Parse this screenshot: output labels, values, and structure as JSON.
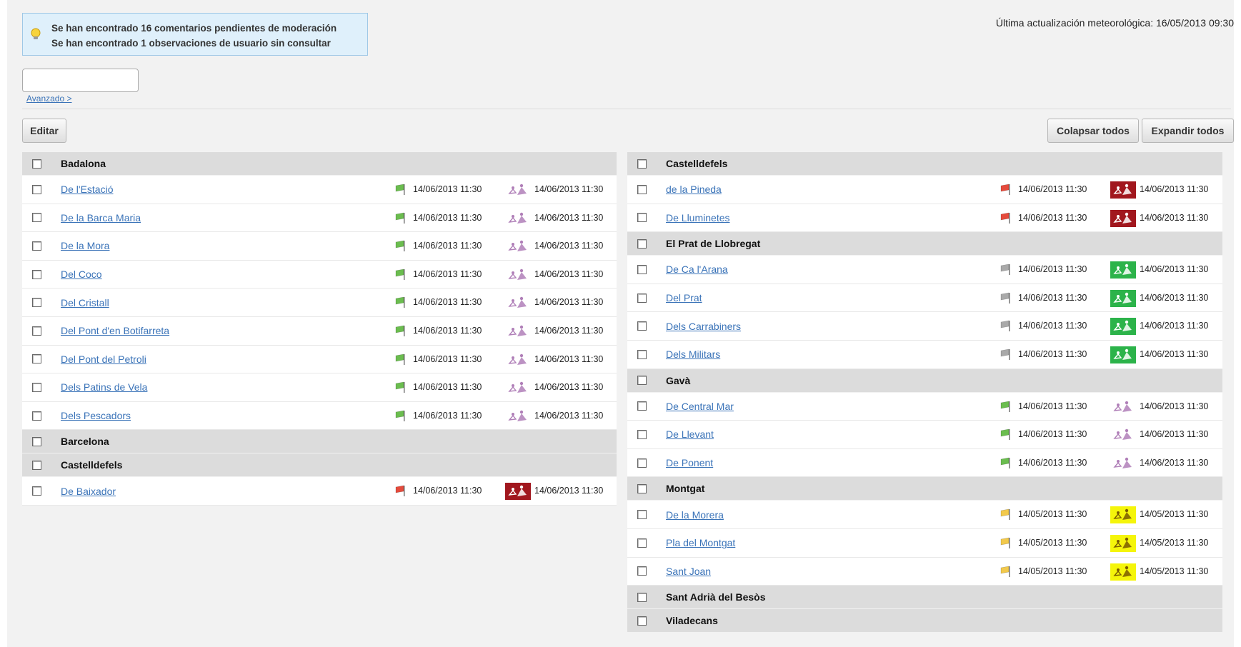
{
  "notice": {
    "line1": "Se han encontrado 16 comentarios pendientes de moderación",
    "line2": "Se han encontrado 1 observaciones de usuario sin consultar"
  },
  "weather_update": "Última actualización meteorológica: 16/05/2013 09:30",
  "search": {
    "value": "",
    "placeholder": ""
  },
  "advanced_label": "Avanzado >",
  "buttons": {
    "edit": "Editar",
    "collapse_all": "Colapsar todos",
    "expand_all": "Expandir todos"
  },
  "colors": {
    "flag_green": "#6bbd4f",
    "flag_red": "#e54b3c",
    "flag_gray": "#a9a9a9",
    "flag_yellow": "#f2c94c",
    "badge_darkred": "#a1171e",
    "badge_green": "#2cb34a",
    "badge_yellow": "#f5f50a",
    "surfer_purple": "#b07fb8"
  },
  "left_column": [
    {
      "type": "group",
      "name": "Badalona"
    },
    {
      "type": "beach",
      "name": "De l'Estació",
      "flag": "green",
      "date1": "14/06/2013 11:30",
      "badge": "none",
      "date2": "14/06/2013 11:30"
    },
    {
      "type": "beach",
      "name": "De la Barca Maria",
      "flag": "green",
      "date1": "14/06/2013 11:30",
      "badge": "none",
      "date2": "14/06/2013 11:30"
    },
    {
      "type": "beach",
      "name": "De la Mora",
      "flag": "green",
      "date1": "14/06/2013 11:30",
      "badge": "none",
      "date2": "14/06/2013 11:30"
    },
    {
      "type": "beach",
      "name": "Del Coco",
      "flag": "green",
      "date1": "14/06/2013 11:30",
      "badge": "none",
      "date2": "14/06/2013 11:30"
    },
    {
      "type": "beach",
      "name": "Del Cristall",
      "flag": "green",
      "date1": "14/06/2013 11:30",
      "badge": "none",
      "date2": "14/06/2013 11:30"
    },
    {
      "type": "beach",
      "name": "Del Pont d'en Botifarreta",
      "flag": "green",
      "date1": "14/06/2013 11:30",
      "badge": "none",
      "date2": "14/06/2013 11:30"
    },
    {
      "type": "beach",
      "name": "Del Pont del Petroli",
      "flag": "green",
      "date1": "14/06/2013 11:30",
      "badge": "none",
      "date2": "14/06/2013 11:30"
    },
    {
      "type": "beach",
      "name": "Dels Patins de Vela",
      "flag": "green",
      "date1": "14/06/2013 11:30",
      "badge": "none",
      "date2": "14/06/2013 11:30"
    },
    {
      "type": "beach",
      "name": "Dels Pescadors",
      "flag": "green",
      "date1": "14/06/2013 11:30",
      "badge": "none",
      "date2": "14/06/2013 11:30"
    },
    {
      "type": "group",
      "name": "Barcelona"
    },
    {
      "type": "group",
      "name": "Castelldefels"
    },
    {
      "type": "beach",
      "name": "De Baixador",
      "flag": "red",
      "date1": "14/06/2013 11:30",
      "badge": "darkred",
      "date2": "14/06/2013 11:30"
    }
  ],
  "right_column": [
    {
      "type": "group",
      "name": "Castelldefels"
    },
    {
      "type": "beach",
      "name": "de la Pineda",
      "flag": "red",
      "date1": "14/06/2013 11:30",
      "badge": "darkred",
      "date2": "14/06/2013 11:30"
    },
    {
      "type": "beach",
      "name": "De Lluminetes",
      "flag": "red",
      "date1": "14/06/2013 11:30",
      "badge": "darkred",
      "date2": "14/06/2013 11:30"
    },
    {
      "type": "group",
      "name": "El Prat de Llobregat"
    },
    {
      "type": "beach",
      "name": "De Ca l'Arana",
      "flag": "gray",
      "date1": "14/06/2013 11:30",
      "badge": "green",
      "date2": "14/06/2013 11:30"
    },
    {
      "type": "beach",
      "name": "Del Prat",
      "flag": "gray",
      "date1": "14/06/2013 11:30",
      "badge": "green",
      "date2": "14/06/2013 11:30"
    },
    {
      "type": "beach",
      "name": "Dels Carrabiners",
      "flag": "gray",
      "date1": "14/06/2013 11:30",
      "badge": "green",
      "date2": "14/06/2013 11:30"
    },
    {
      "type": "beach",
      "name": "Dels Militars",
      "flag": "gray",
      "date1": "14/06/2013 11:30",
      "badge": "green",
      "date2": "14/06/2013 11:30"
    },
    {
      "type": "group",
      "name": "Gavà"
    },
    {
      "type": "beach",
      "name": "De Central Mar",
      "flag": "green",
      "date1": "14/06/2013 11:30",
      "badge": "none",
      "date2": "14/06/2013 11:30"
    },
    {
      "type": "beach",
      "name": "De Llevant",
      "flag": "green",
      "date1": "14/06/2013 11:30",
      "badge": "none",
      "date2": "14/06/2013 11:30"
    },
    {
      "type": "beach",
      "name": "De Ponent",
      "flag": "green",
      "date1": "14/06/2013 11:30",
      "badge": "none",
      "date2": "14/06/2013 11:30"
    },
    {
      "type": "group",
      "name": "Montgat"
    },
    {
      "type": "beach",
      "name": "De la Morera",
      "flag": "yellow",
      "date1": "14/05/2013 11:30",
      "badge": "yellow",
      "date2": "14/05/2013 11:30"
    },
    {
      "type": "beach",
      "name": "Pla del Montgat",
      "flag": "yellow",
      "date1": "14/05/2013 11:30",
      "badge": "yellow",
      "date2": "14/05/2013 11:30"
    },
    {
      "type": "beach",
      "name": "Sant Joan",
      "flag": "yellow",
      "date1": "14/05/2013 11:30",
      "badge": "yellow",
      "date2": "14/05/2013 11:30"
    },
    {
      "type": "group",
      "name": "Sant Adrià del Besòs"
    },
    {
      "type": "group",
      "name": "Viladecans"
    }
  ]
}
